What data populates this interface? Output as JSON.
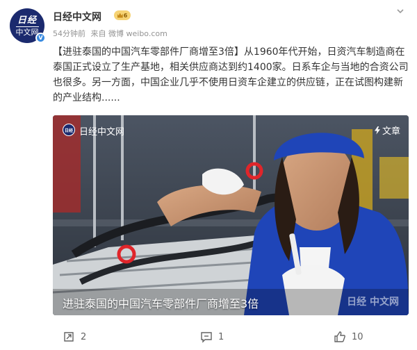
{
  "post": {
    "avatar": {
      "line1": "日经",
      "line2": "中文网"
    },
    "username": "日经中文网",
    "rank_level": "6",
    "meta": {
      "time": "54分钟前",
      "source": "来自 微博 weibo.com"
    },
    "text": "【进驻泰国的中国汽车零部件厂商增至3倍】从1960年代开始，日资汽车制造商在泰国正式设立了生产基地，相关供应商达到约1400家。日系车企与当地的合资公司也很多。另一方面，中国企业几乎不使用日资车企建立的供应链，正在试图构建新的产业结构......"
  },
  "media": {
    "logo_text": "日经",
    "author": "日经中文网",
    "type_label": "文章",
    "caption": "进驻泰国的中国汽车零部件厂商增至3倍",
    "watermark": "日经 中文网"
  },
  "actions": {
    "repost_count": "2",
    "comment_count": "1",
    "like_count": "10"
  },
  "colors": {
    "text": "#333333",
    "meta": "#939393",
    "worker_uniform": "#1f45b8",
    "chain_hook": "#e0252a"
  }
}
